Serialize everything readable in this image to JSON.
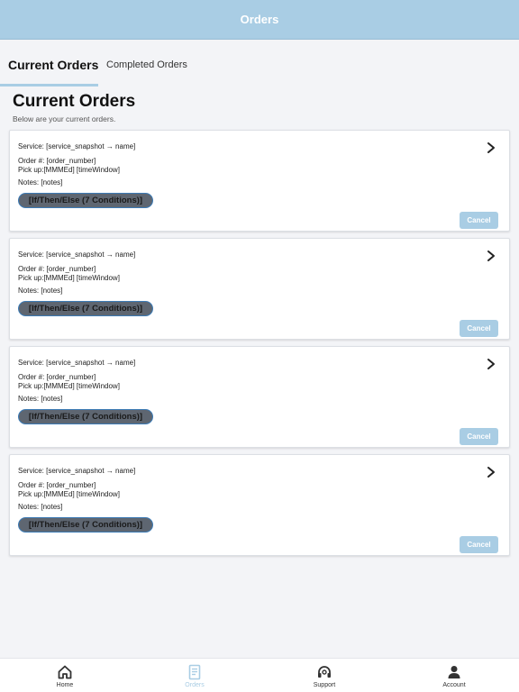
{
  "header": {
    "title": "Orders"
  },
  "tabs": [
    {
      "label": "Current Orders",
      "active": true
    },
    {
      "label": "Completed Orders",
      "active": false
    }
  ],
  "main": {
    "title": "Current Orders",
    "subtitle": "Below are your current orders."
  },
  "orders": [
    {
      "service": "Service: [service_snapshot → name]",
      "order_number": "Order #: [order_number]",
      "pickup": "Pick up:[MMMEd] [timeWindow]",
      "notes": "Notes: [notes]",
      "condition": "[If/Then/Else (7 Conditions)]",
      "cancel_label": "Cancel"
    },
    {
      "service": "Service: [service_snapshot → name]",
      "order_number": "Order #: [order_number]",
      "pickup": "Pick up:[MMMEd] [timeWindow]",
      "notes": "Notes: [notes]",
      "condition": "[If/Then/Else (7 Conditions)]",
      "cancel_label": "Cancel"
    },
    {
      "service": "Service: [service_snapshot → name]",
      "order_number": "Order #: [order_number]",
      "pickup": "Pick up:[MMMEd] [timeWindow]",
      "notes": "Notes: [notes]",
      "condition": "[If/Then/Else (7 Conditions)]",
      "cancel_label": "Cancel"
    },
    {
      "service": "Service: [service_snapshot → name]",
      "order_number": "Order #: [order_number]",
      "pickup": "Pick up:[MMMEd] [timeWindow]",
      "notes": "Notes: [notes]",
      "condition": "[If/Then/Else (7 Conditions)]",
      "cancel_label": "Cancel"
    }
  ],
  "bottom_nav": [
    {
      "label": "Home",
      "icon": "home-icon",
      "active": false
    },
    {
      "label": "Orders",
      "icon": "orders-icon",
      "active": true
    },
    {
      "label": "Support",
      "icon": "support-icon",
      "active": false
    },
    {
      "label": "Account",
      "icon": "account-icon",
      "active": false
    }
  ],
  "colors": {
    "accent": "#a9cde4",
    "condition_pill": "#5e6671",
    "condition_border": "#3d7bb5",
    "background": "#f3f4f7"
  }
}
